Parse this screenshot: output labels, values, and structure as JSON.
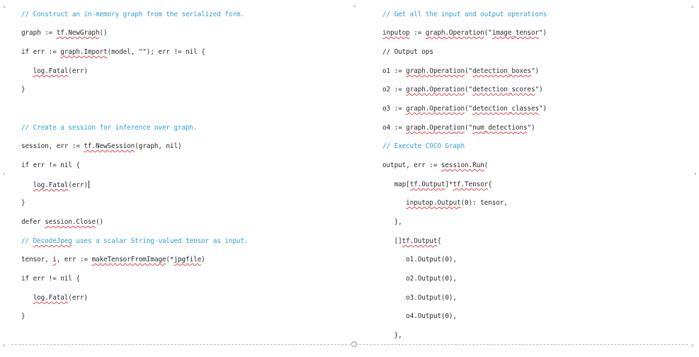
{
  "document": {
    "left_column": [
      {
        "segments": [
          {
            "t": "// Construct an in-memory graph from the serialized form."
          }
        ],
        "comment": true
      },
      {
        "segments": [
          {
            "t": "graph := "
          },
          {
            "t": "tf.NewGraph",
            "u": true
          },
          {
            "t": "()"
          }
        ]
      },
      {
        "segments": [
          {
            "t": "if err := "
          },
          {
            "t": "graph.Import",
            "u": true
          },
          {
            "t": "(model, \"\"); err != nil {"
          }
        ]
      },
      {
        "segments": [
          {
            "t": "   "
          },
          {
            "t": "log.Fatal",
            "u": true
          },
          {
            "t": "(err)"
          }
        ]
      },
      {
        "segments": [
          {
            "t": "}"
          }
        ]
      },
      {
        "segments": [
          {
            "t": "// Create a session for inference over graph."
          }
        ],
        "comment": true
      },
      {
        "segments": [
          {
            "t": "session, err := "
          },
          {
            "t": "tf.NewSession",
            "u": true
          },
          {
            "t": "(graph, nil)"
          }
        ]
      },
      {
        "segments": [
          {
            "t": "if err != nil {"
          }
        ]
      },
      {
        "segments": [
          {
            "t": "   "
          },
          {
            "t": "log.Fatal",
            "u": true
          },
          {
            "t": "(err)"
          }
        ],
        "caret": true
      },
      {
        "segments": [
          {
            "t": "}"
          }
        ]
      },
      {
        "segments": [
          {
            "t": "defer "
          },
          {
            "t": "session.Close",
            "u": true
          },
          {
            "t": "()"
          }
        ]
      },
      {
        "segments": [
          {
            "t": "// "
          },
          {
            "t": "DecodeJpeg",
            "u": true
          },
          {
            "t": " uses a scalar String-valued tensor as input."
          }
        ],
        "comment": true
      },
      {
        "segments": [
          {
            "t": "tensor, "
          },
          {
            "t": "i",
            "u": true
          },
          {
            "t": ", err := "
          },
          {
            "t": "makeTensorFromImage",
            "u": true
          },
          {
            "t": "(*"
          },
          {
            "t": "jpgfile",
            "u": true
          },
          {
            "t": ")"
          }
        ]
      },
      {
        "segments": [
          {
            "t": "if err != nil {"
          }
        ]
      },
      {
        "segments": [
          {
            "t": "   "
          },
          {
            "t": "log.Fatal",
            "u": true
          },
          {
            "t": "(err)"
          }
        ]
      },
      {
        "segments": [
          {
            "t": "}"
          }
        ]
      }
    ],
    "right_column": [
      {
        "segments": [
          {
            "t": "// Get all the input and output operations"
          }
        ],
        "comment": true
      },
      {
        "segments": [
          {
            "t": "inputop",
            "u": true
          },
          {
            "t": " := "
          },
          {
            "t": "graph.Operation",
            "u": true
          },
          {
            "t": "(\""
          },
          {
            "t": "image_tensor",
            "u": true
          },
          {
            "t": "\")"
          }
        ]
      },
      {
        "segments": [
          {
            "t": "// Output ops"
          }
        ]
      },
      {
        "segments": [
          {
            "t": "o1 := "
          },
          {
            "t": "graph.Operation",
            "u": true
          },
          {
            "t": "(\""
          },
          {
            "t": "detection_boxes",
            "u": true
          },
          {
            "t": "\")"
          }
        ]
      },
      {
        "segments": [
          {
            "t": "o2 := "
          },
          {
            "t": "graph.Operation",
            "u": true
          },
          {
            "t": "(\""
          },
          {
            "t": "detection_scores",
            "u": true
          },
          {
            "t": "\")"
          }
        ]
      },
      {
        "segments": [
          {
            "t": "o3 := "
          },
          {
            "t": "graph.Operation",
            "u": true
          },
          {
            "t": "(\""
          },
          {
            "t": "detection_classes",
            "u": true
          },
          {
            "t": "\")"
          }
        ]
      },
      {
        "segments": [
          {
            "t": "o4 := "
          },
          {
            "t": "graph.Operation",
            "u": true
          },
          {
            "t": "(\""
          },
          {
            "t": "num_detections",
            "u": true
          },
          {
            "t": "\")"
          }
        ]
      },
      {
        "segments": [
          {
            "t": "// Execute COCO Graph"
          }
        ],
        "comment": true
      },
      {
        "segments": [
          {
            "t": "output, err := "
          },
          {
            "t": "session.Run",
            "u": true
          },
          {
            "t": "("
          }
        ]
      },
      {
        "segments": [
          {
            "t": "   map["
          },
          {
            "t": "tf.Output",
            "u": true
          },
          {
            "t": "]*"
          },
          {
            "t": "tf.Tensor",
            "u": true
          },
          {
            "t": "{"
          }
        ]
      },
      {
        "segments": [
          {
            "t": "      "
          },
          {
            "t": "inputop.Output",
            "u": true
          },
          {
            "t": "(0): tensor,"
          }
        ]
      },
      {
        "segments": [
          {
            "t": "   },"
          }
        ]
      },
      {
        "segments": [
          {
            "t": "   []"
          },
          {
            "t": "tf.Output",
            "u": true
          },
          {
            "t": "{"
          }
        ]
      },
      {
        "segments": [
          {
            "t": "      o1.Output(0),"
          }
        ]
      },
      {
        "segments": [
          {
            "t": "      o2.Output(0),"
          }
        ]
      },
      {
        "segments": [
          {
            "t": "      o3.Output(0),"
          }
        ]
      },
      {
        "segments": [
          {
            "t": "      o4.Output(0),"
          }
        ]
      },
      {
        "segments": [
          {
            "t": "   },"
          }
        ]
      }
    ]
  },
  "colors": {
    "comment": "#2f9fd6",
    "code": "#2b2b2b",
    "spell_underline": "#e0464f"
  }
}
